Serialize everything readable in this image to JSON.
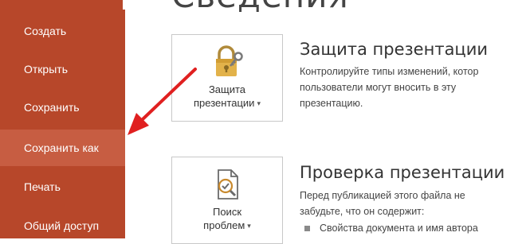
{
  "page": {
    "title": "Сведения"
  },
  "sidebar": {
    "items": [
      {
        "label": "Создать"
      },
      {
        "label": "Открыть"
      },
      {
        "label": "Сохранить"
      },
      {
        "label": "Сохранить как"
      },
      {
        "label": "Печать"
      },
      {
        "label": "Общий доступ"
      }
    ],
    "selected_index": 3
  },
  "sections": {
    "protect": {
      "tile_line1": "Защита",
      "tile_line2": "презентации",
      "icon": "lock-key-icon",
      "title": "Защита презентации",
      "desc_line1": "Контролируйте типы изменений, котор",
      "desc_line2": "пользователи могут вносить в эту",
      "desc_line3": "презентацию."
    },
    "inspect": {
      "tile_line1": "Поиск",
      "tile_line2": "проблем",
      "icon": "document-check-icon",
      "title": "Проверка презентации",
      "desc_line1": "Перед публикацией этого файла не",
      "desc_line2": "забудьте, что он содержит:",
      "bullet1": "Свойства документа и имя автора"
    }
  },
  "colors": {
    "sidebar": "#b7472a",
    "selected": "#c75d42",
    "arrow": "#e02020"
  }
}
